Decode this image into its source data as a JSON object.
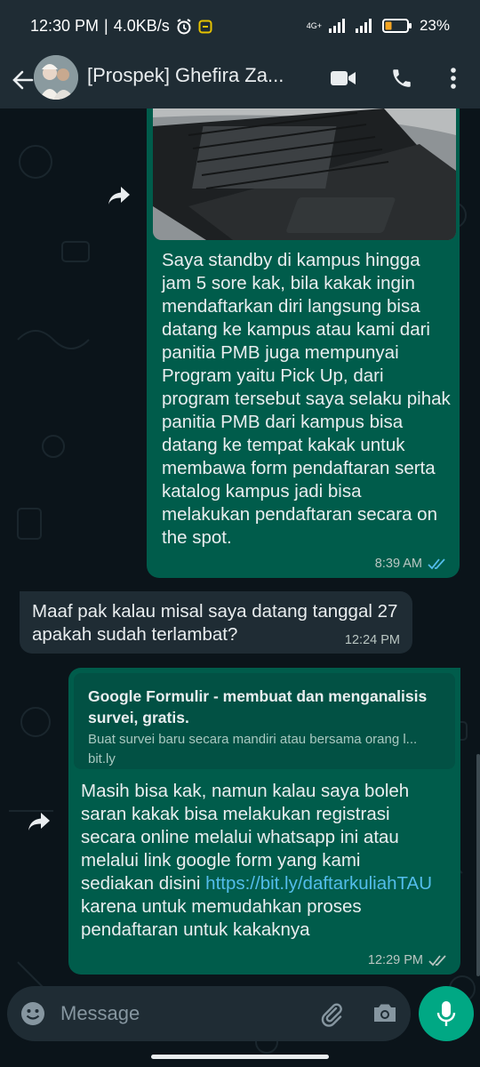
{
  "status_bar": {
    "time": "12:30 PM",
    "net_speed": "4.0KB/s",
    "signal_type": "4G+",
    "battery": "23%"
  },
  "header": {
    "contact_name": "[Prospek] Ghefira Za...",
    "icons": [
      "back-arrow-icon",
      "video-call-icon",
      "voice-call-icon",
      "more-options-icon"
    ]
  },
  "messages": [
    {
      "direction": "outgoing",
      "text": "Saya standby di kampus hingga jam 5 sore kak, bila kakak ingin mendaftarkan diri langsung bisa datang ke kampus atau kami dari panitia PMB juga mempunyai Program yaitu Pick Up, dari program tersebut saya selaku pihak panitia PMB dari kampus bisa datang ke tempat kakak untuk membawa form pendaftaran serta katalog kampus jadi bisa melakukan pendaftaran secara on the spot.",
      "time": "8:39 AM",
      "read": true
    },
    {
      "direction": "incoming",
      "text": "Maaf pak kalau misal saya datang tanggal 27 apakah sudah terlambat?",
      "time": "12:24 PM"
    },
    {
      "direction": "outgoing",
      "preview_title": "Google Formulir - membuat dan menganalisis survei, gratis.",
      "preview_desc": "Buat survei baru secara mandiri atau bersama orang l...",
      "preview_domain": "bit.ly",
      "text_before": "Masih bisa kak, namun kalau saya boleh saran kakak bisa melakukan registrasi secara online melalui whatsapp ini atau melalui link google form yang kami sediakan disini ",
      "link": "https://bit.ly/daftarkuliahTAU",
      "text_after": " karena untuk memudahkan proses pendaftaran untuk kakaknya",
      "time": "12:29 PM",
      "read": false
    }
  ],
  "input": {
    "placeholder": "Message"
  },
  "colors": {
    "outgoing_bubble": "#005c4b",
    "incoming_bubble": "#1f2c34",
    "accent": "#00a884",
    "link": "#53bdeb",
    "read_tick": "#53bdeb"
  }
}
